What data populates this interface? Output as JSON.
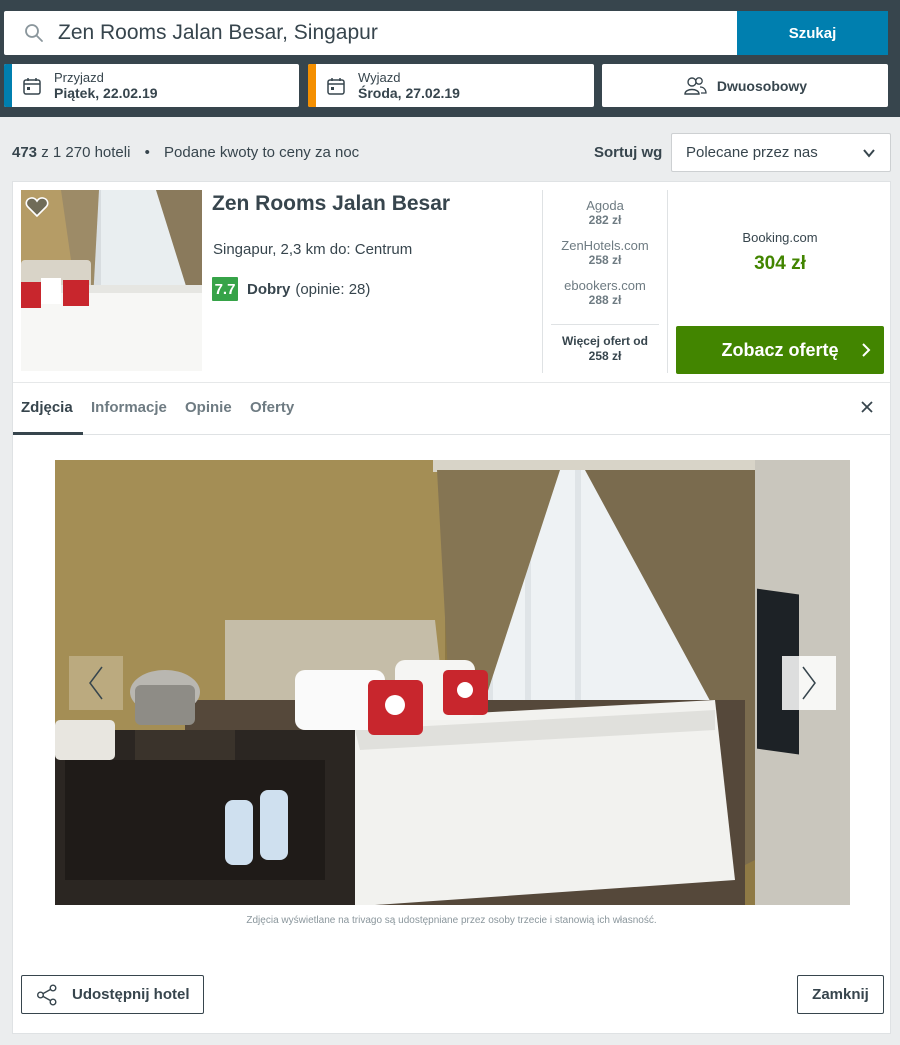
{
  "search": {
    "query": "Zen Rooms Jalan Besar, Singapur",
    "button_label": "Szukaj"
  },
  "dates": {
    "checkin": {
      "label": "Przyjazd",
      "value": "Piątek, 22.02.19"
    },
    "checkout": {
      "label": "Wyjazd",
      "value": "Środa, 27.02.19"
    }
  },
  "room": {
    "label": "Dwuosobowy"
  },
  "results": {
    "count": "473",
    "of_total": "z 1 270 hoteli",
    "separator": "•",
    "note": "Podane kwoty to ceny za noc"
  },
  "sort": {
    "label": "Sortuj wg",
    "selected": "Polecane przez nas"
  },
  "hotel": {
    "name": "Zen Rooms Jalan Besar",
    "location": "Singapur, 2,3 km do: Centrum",
    "rating_score": "7.7",
    "rating_word": "Dobry",
    "rating_count": "(opinie: 28)",
    "partners": [
      {
        "name": "Agoda",
        "price": "282 zł"
      },
      {
        "name": "ZenHotels.com",
        "price": "258 zł"
      },
      {
        "name": "ebookers.com",
        "price": "288 zł"
      }
    ],
    "more_offers_label": "Więcej ofert od",
    "more_offers_price": "258 zł",
    "main_offer_name": "Booking.com",
    "main_offer_price": "304 zł",
    "deal_button_label": "Zobacz ofertę"
  },
  "tabs": [
    {
      "label": "Zdjęcia",
      "active": true
    },
    {
      "label": "Informacje",
      "active": false
    },
    {
      "label": "Opinie",
      "active": false
    },
    {
      "label": "Oferty",
      "active": false
    }
  ],
  "gallery": {
    "disclaimer": "Zdjęcia wyświetlane na trivago są udostępniane przez osoby trzecie i stanowią ich własność."
  },
  "footer": {
    "share_label": "Udostępnij hotel",
    "close_label": "Zamknij"
  },
  "colors": {
    "header_bg": "#37454d",
    "search_button": "#007faf",
    "checkin_accent": "#007faf",
    "checkout_accent": "#f48f00",
    "rating_green": "#36a348",
    "deal_green": "#428500"
  }
}
